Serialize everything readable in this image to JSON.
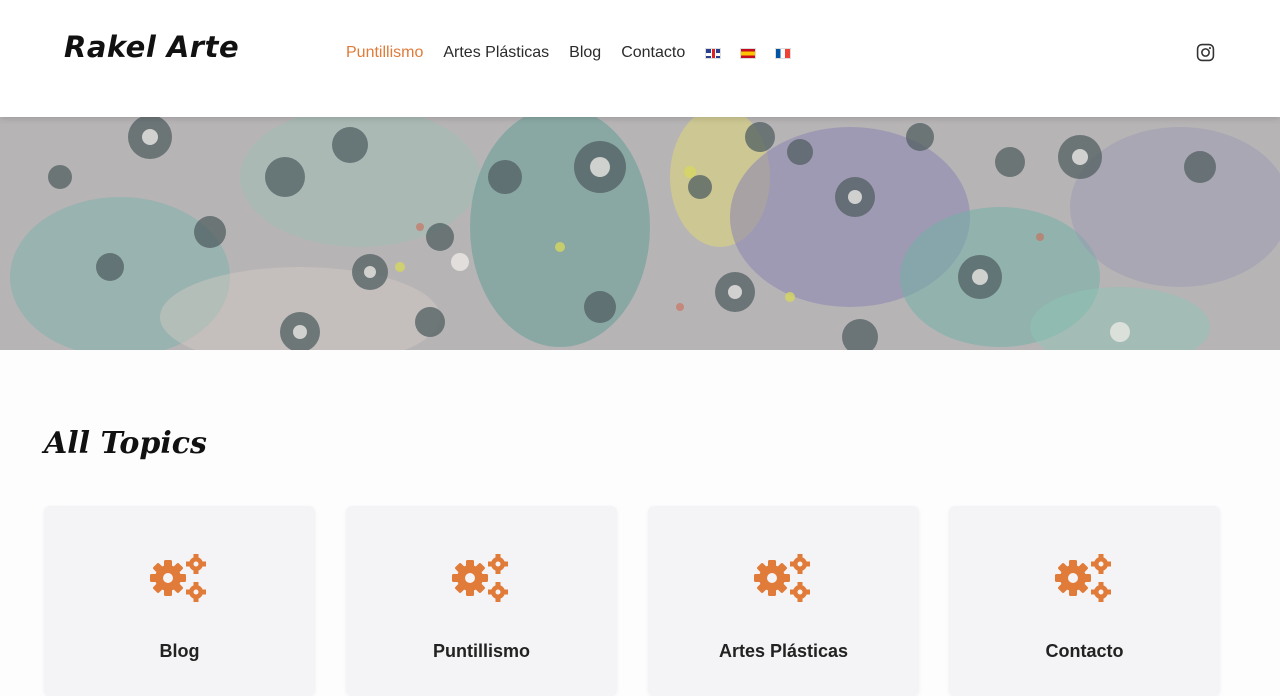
{
  "header": {
    "logo": "Rakel Arte",
    "nav": [
      {
        "label": "Puntillismo",
        "active": true
      },
      {
        "label": "Artes Plásticas",
        "active": false
      },
      {
        "label": "Blog",
        "active": false
      },
      {
        "label": "Contacto",
        "active": false
      }
    ],
    "languages": [
      "flag-uk-icon",
      "flag-es-icon",
      "flag-fr-icon"
    ],
    "social_icon": "instagram-icon"
  },
  "main": {
    "section_title": "All Topics",
    "topics": [
      {
        "label": "Blog",
        "icon": "gears-icon"
      },
      {
        "label": "Puntillismo",
        "icon": "gears-icon"
      },
      {
        "label": "Artes Plásticas",
        "icon": "gears-icon"
      },
      {
        "label": "Contacto",
        "icon": "gears-icon"
      }
    ]
  },
  "colors": {
    "accent": "#e07b39",
    "card_bg": "#f4f3f5"
  }
}
